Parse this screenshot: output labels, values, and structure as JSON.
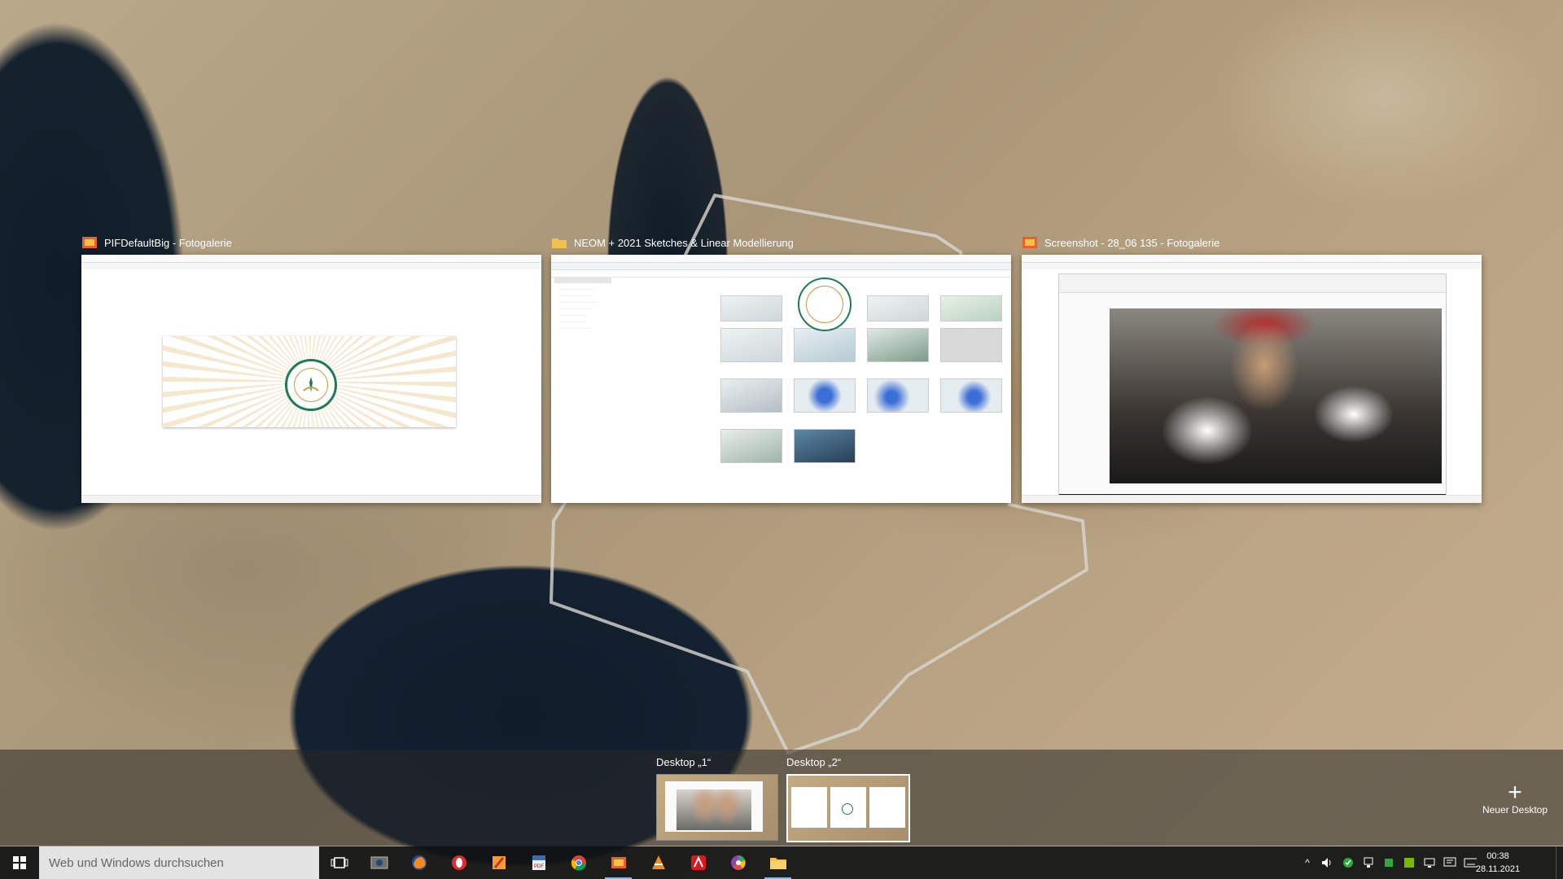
{
  "windows": [
    {
      "title": "PIFDefaultBig - Fotogalerie",
      "app_icon": "photo-gallery-icon"
    },
    {
      "title": "NEOM + 2021 Sketches & Linear Modellierung",
      "app_icon": "folder-icon"
    },
    {
      "title": "Screenshot - 28_06 135 - Fotogalerie",
      "app_icon": "photo-gallery-icon"
    }
  ],
  "desktops": [
    {
      "label": "Desktop „1“"
    },
    {
      "label": "Desktop „2“",
      "active": true
    }
  ],
  "new_desktop_label": "Neuer Desktop",
  "taskbar": {
    "search_placeholder": "Web und Windows durchsuchen",
    "apps": [
      "task-view-icon",
      "photo-app-icon",
      "firefox-icon",
      "opera-icon",
      "pdf-app-icon",
      "pdf-viewer-icon",
      "chrome-icon",
      "photo-gallery-icon",
      "vlc-icon",
      "avira-icon",
      "picasa-icon",
      "file-explorer-icon"
    ],
    "time": "00:38",
    "date": "28.11.2021"
  },
  "colors": {
    "accent": "#8fb5e0",
    "taskbar": "#101214"
  }
}
